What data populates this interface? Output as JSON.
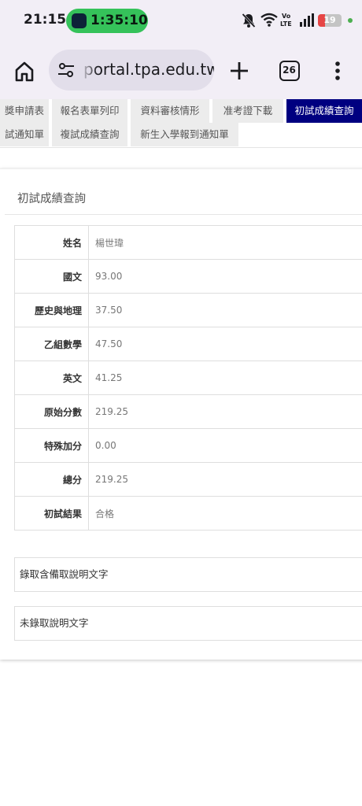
{
  "status_bar": {
    "time": "21:15",
    "call_timer": "1:35:10",
    "battery_level": "19",
    "icons": [
      "bell-off-icon",
      "wifi-icon",
      "volte-icon",
      "signal-icon",
      "battery-icon",
      "green-dot-icon"
    ]
  },
  "browser": {
    "url": "portal.tpa.edu.tw",
    "tab_count": "26",
    "icons": [
      "home-icon",
      "tune-icon",
      "plus-icon",
      "tabs-icon",
      "more-vert-icon"
    ]
  },
  "nav": {
    "row1": [
      "獎申請表",
      "報名表單列印",
      "資料審核情形",
      "准考證下載",
      "初試成績查詢"
    ],
    "row2": [
      "試通知單",
      "複試成績查詢",
      "新生入學報到通知單"
    ],
    "active": "初試成績查詢"
  },
  "panel": {
    "title": "初試成績查詢",
    "rows": [
      {
        "label": "姓名",
        "value": "楊世瑋"
      },
      {
        "label": "國文",
        "value": "93.00"
      },
      {
        "label": "歷史與地理",
        "value": "37.50"
      },
      {
        "label": "乙組數學",
        "value": "47.50"
      },
      {
        "label": "英文",
        "value": "41.25"
      },
      {
        "label": "原始分數",
        "value": "219.25"
      },
      {
        "label": "特殊加分",
        "value": "0.00"
      },
      {
        "label": "總分",
        "value": "219.25"
      },
      {
        "label": "初試結果",
        "value": "合格"
      }
    ],
    "notes": [
      "錄取含備取說明文字",
      "未錄取說明文字"
    ]
  }
}
